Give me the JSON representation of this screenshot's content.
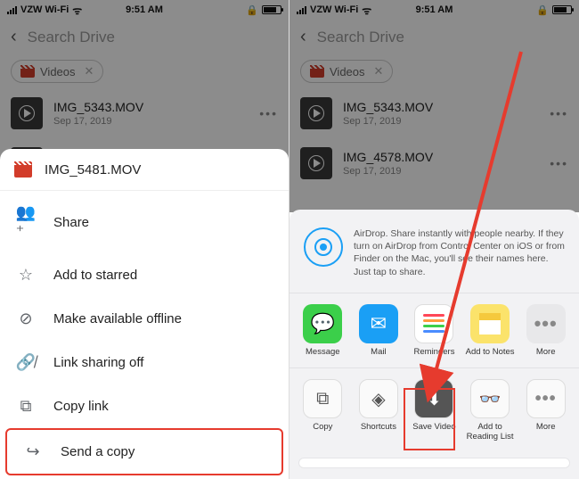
{
  "status": {
    "carrier": "VZW Wi-Fi",
    "time": "9:51 AM"
  },
  "search": {
    "placeholder": "Search Drive"
  },
  "chip": {
    "label": "Videos"
  },
  "files": [
    {
      "name": "IMG_5343.MOV",
      "date": "Sep 17, 2019"
    },
    {
      "name": "IMG_4578.MOV",
      "date": "Sep 17, 2019"
    }
  ],
  "sheet_left": {
    "title": "IMG_5481.MOV",
    "items": [
      {
        "icon": "person-add",
        "label": "Share"
      },
      {
        "icon": "star",
        "label": "Add to starred"
      },
      {
        "icon": "offline",
        "label": "Make available offline"
      },
      {
        "icon": "link-off",
        "label": "Link sharing off"
      },
      {
        "icon": "copy",
        "label": "Copy link"
      },
      {
        "icon": "send",
        "label": "Send a copy"
      }
    ]
  },
  "sheet_right": {
    "airdrop": "AirDrop. Share instantly with people nearby. If they turn on AirDrop from Control Center on iOS or from Finder on the Mac, you'll see their names here. Just tap to share.",
    "apps": [
      {
        "label": "Message"
      },
      {
        "label": "Mail"
      },
      {
        "label": "Reminders"
      },
      {
        "label": "Add to Notes"
      },
      {
        "label": "More"
      }
    ],
    "actions": [
      {
        "label": "Copy"
      },
      {
        "label": "Shortcuts"
      },
      {
        "label": "Save Video"
      },
      {
        "label": "Add to Reading List"
      },
      {
        "label": "More"
      }
    ]
  }
}
